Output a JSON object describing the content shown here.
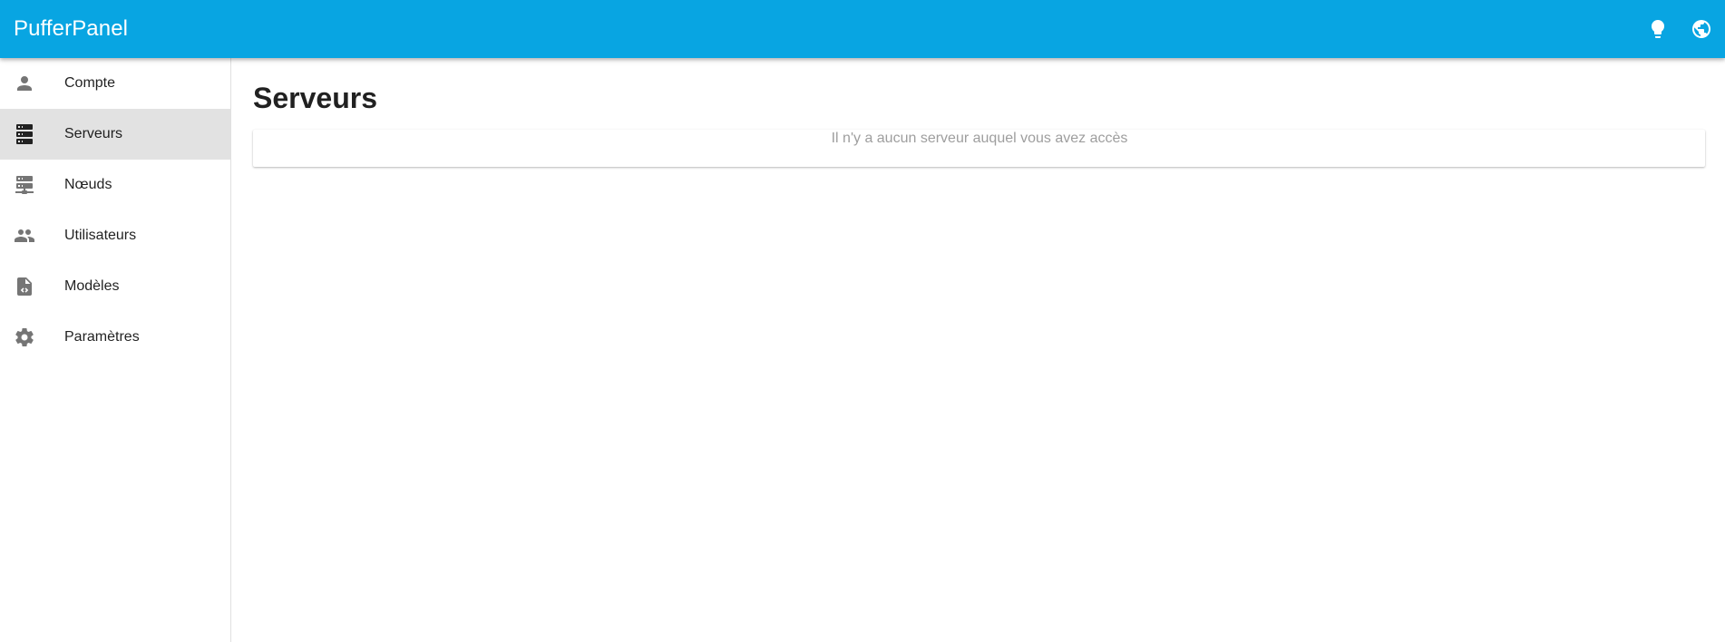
{
  "app": {
    "title": "PufferPanel"
  },
  "header": {
    "actions": [
      {
        "name": "theme-toggle",
        "icon": "lightbulb-icon"
      },
      {
        "name": "language-select",
        "icon": "globe-icon"
      }
    ]
  },
  "sidebar": {
    "items": [
      {
        "label": "Compte",
        "icon": "account-icon",
        "active": false
      },
      {
        "label": "Serveurs",
        "icon": "server-icon",
        "active": true
      },
      {
        "label": "Nœuds",
        "icon": "server-network-icon",
        "active": false
      },
      {
        "label": "Utilisateurs",
        "icon": "users-icon",
        "active": false
      },
      {
        "label": "Modèles",
        "icon": "file-code-icon",
        "active": false
      },
      {
        "label": "Paramètres",
        "icon": "gear-icon",
        "active": false
      }
    ]
  },
  "main": {
    "title": "Serveurs",
    "empty_message": "Il n'y a aucun serveur auquel vous avez accès"
  },
  "colors": {
    "primary": "#08a5e2",
    "active_item_bg": "#e2e2e2",
    "muted_text": "#9e9e9e"
  }
}
